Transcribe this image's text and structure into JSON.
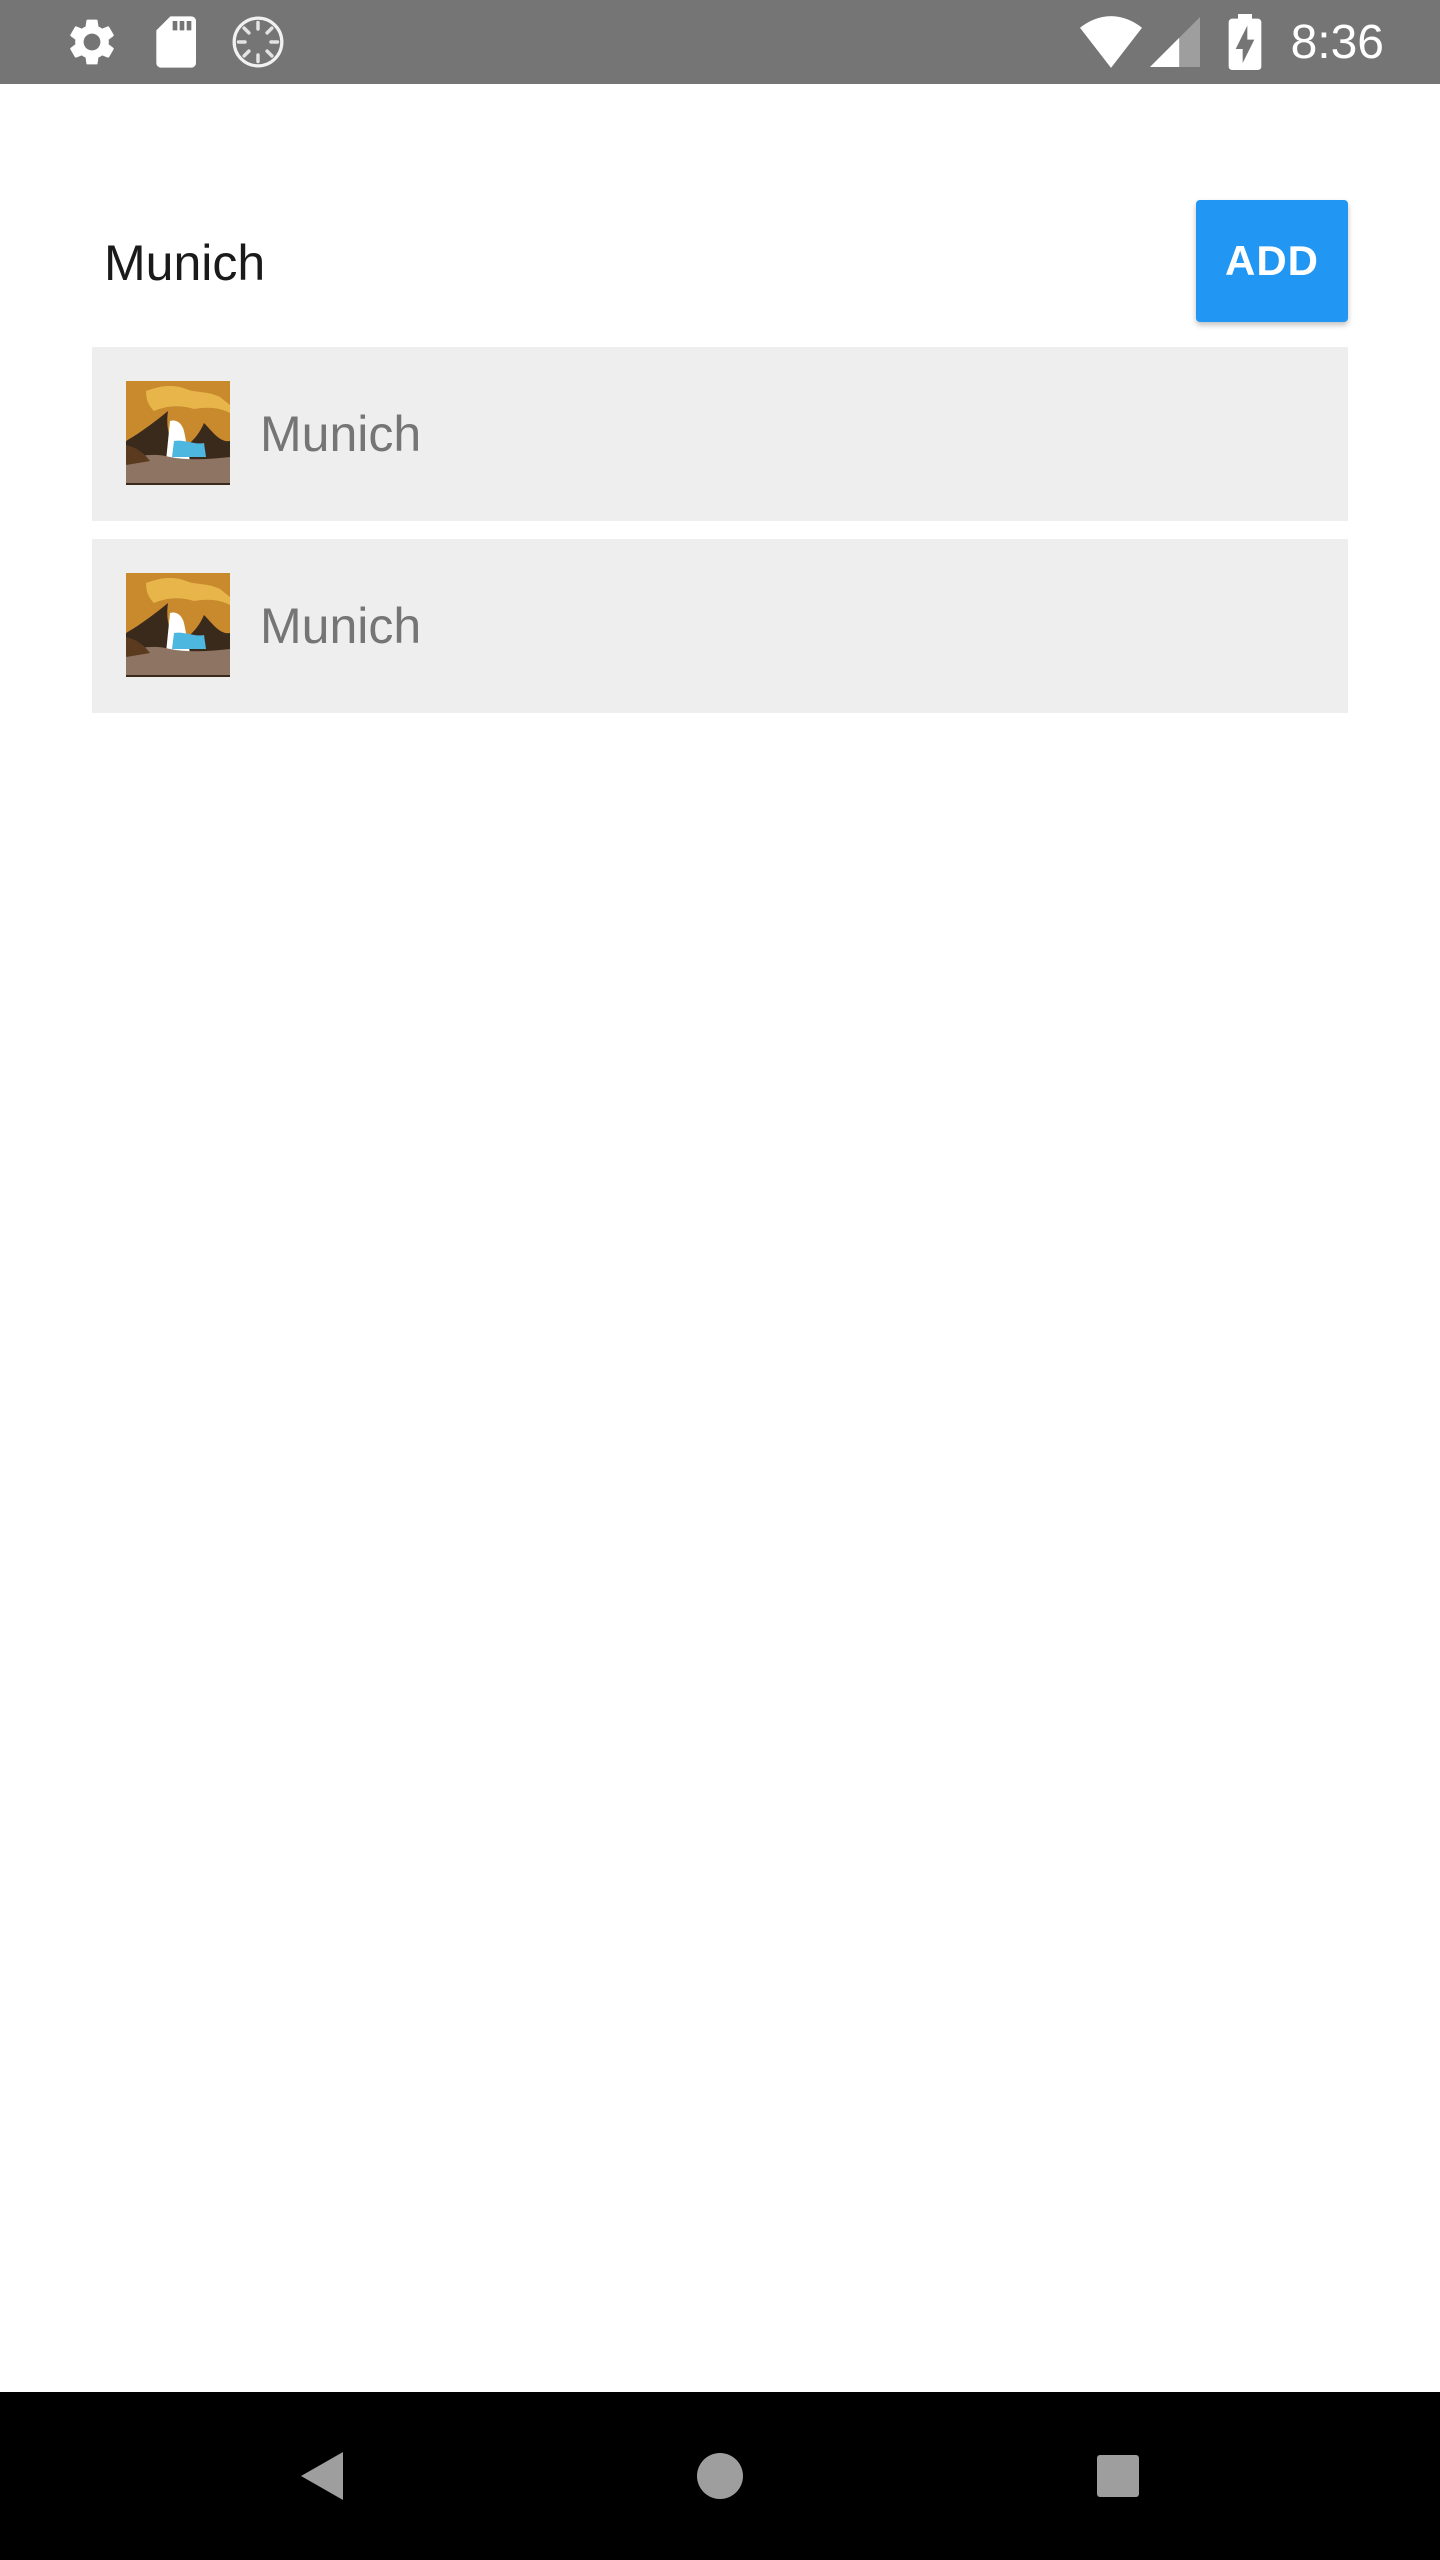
{
  "status_bar": {
    "time": "8:36",
    "icons": [
      "settings-icon",
      "sd-card-icon",
      "sync-icon",
      "wifi-icon",
      "signal-icon",
      "battery-charging-icon"
    ]
  },
  "city_input": {
    "value": "Munich"
  },
  "add_button": {
    "label": "ADD",
    "color": "#2196F3"
  },
  "cities": [
    {
      "name": "Munich",
      "thumbnail": "cave-beach-thumbnail"
    },
    {
      "name": "Munich",
      "thumbnail": "cave-beach-thumbnail"
    }
  ],
  "nav_bar": {
    "icons": [
      "back-icon",
      "home-icon",
      "recents-icon"
    ]
  }
}
